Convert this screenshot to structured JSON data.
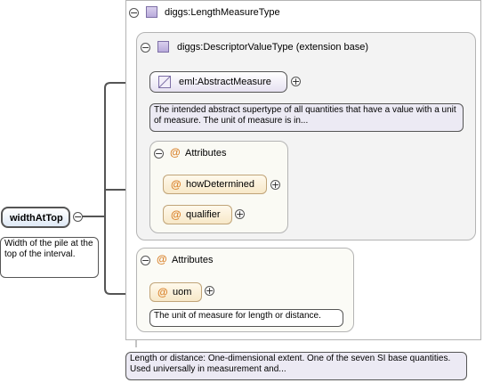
{
  "root_element": {
    "name": "widthAtTop",
    "doc": "Width of the pile at the top of the interval."
  },
  "type": {
    "name": "diggs:LengthMeasureType",
    "doc": "Length or distance: One-dimensional extent. One of the seven SI base quantities. Used universally in measurement and..."
  },
  "base": {
    "name": "diggs:DescriptorValueType (extension base)"
  },
  "abstract_measure": {
    "name": "eml:AbstractMeasure",
    "doc": "The intended abstract supertype of all quantities that have a value with a unit of measure. The unit of measure is in..."
  },
  "inner_attributes": {
    "title": "Attributes",
    "items": [
      {
        "name": "howDetermined"
      },
      {
        "name": "qualifier"
      }
    ]
  },
  "outer_attributes": {
    "title": "Attributes",
    "items": [
      {
        "name": "uom",
        "doc": "The unit of measure for length or distance."
      }
    ]
  },
  "icons": {
    "collapse": "minus-toggle-icon",
    "expand": "plus-toggle-icon",
    "type": "complex-type-icon",
    "attribute": "attribute-at-icon"
  },
  "colors": {
    "attribute_marker": "#d9822b",
    "type_icon": "#b8aadb",
    "element_fill": "#dfe9f6"
  }
}
